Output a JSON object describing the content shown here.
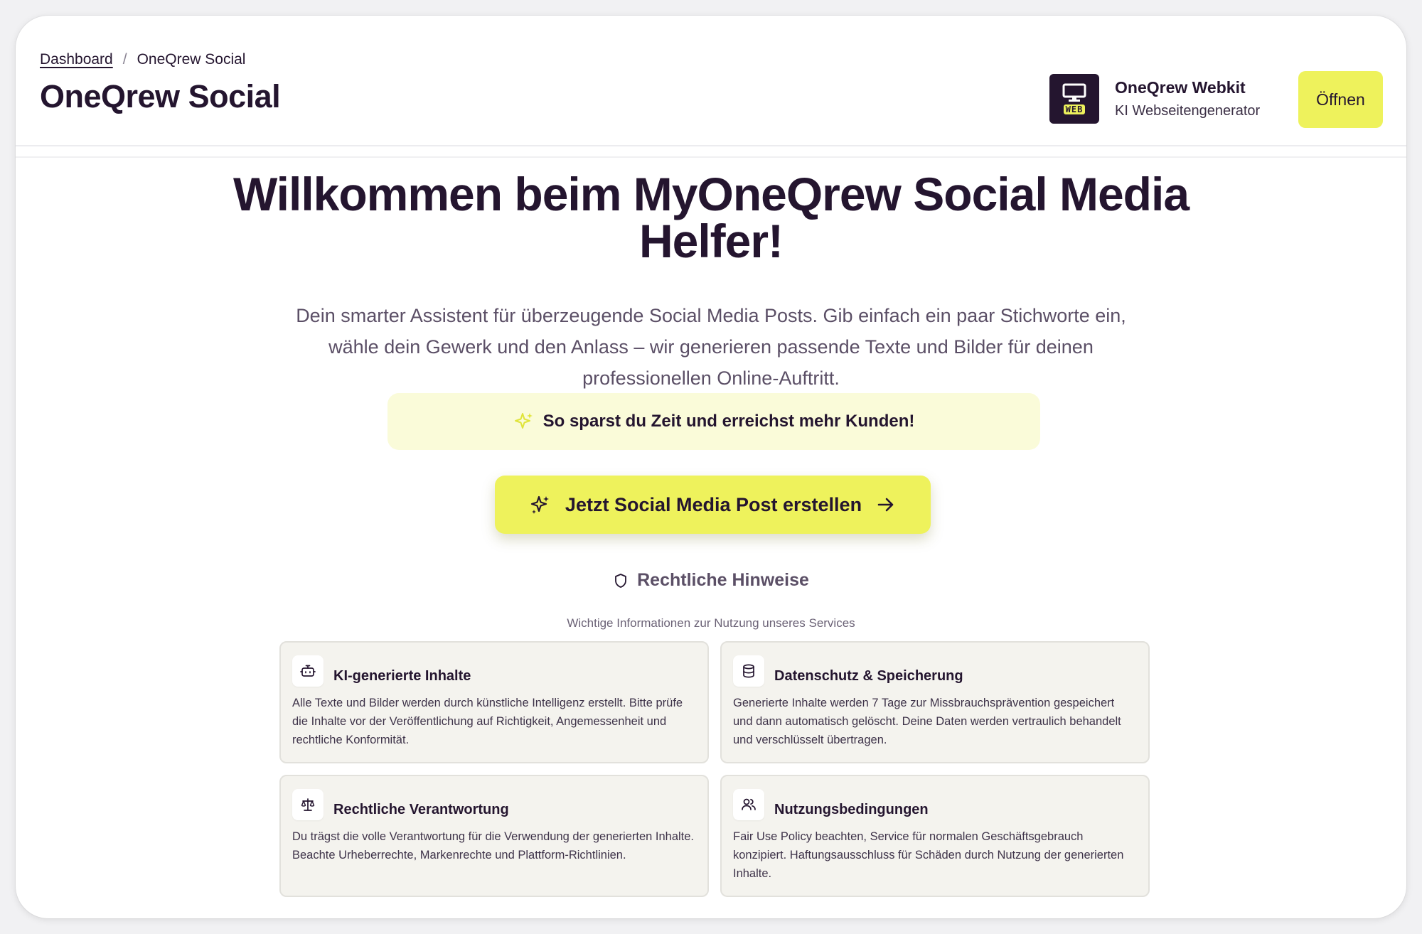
{
  "breadcrumb": {
    "home": "Dashboard",
    "separator": "/",
    "current": "OneQrew Social"
  },
  "header": {
    "title": "OneQrew Social"
  },
  "promo": {
    "logo_tag": "WEB",
    "name": "OneQrew Webkit",
    "description": "KI Webseitengenerator",
    "open_label": "Öffnen"
  },
  "hero": {
    "title": "Willkommen beim MyOneQrew Social Media Helfer!",
    "description": "Dein smarter Assistent für überzeugende Social Media Posts. Gib einfach ein paar Stichworte ein, wähle dein Gewerk und den Anlass – wir generieren passende Texte und Bilder für deinen professionellen Online-Auftritt.",
    "tip": "So sparst du Zeit und erreichst mehr Kunden!",
    "cta_label": "Jetzt Social Media Post erstellen"
  },
  "legal": {
    "title": "Rechtliche Hinweise",
    "subtitle": "Wichtige Informationen zur Nutzung unseres Services",
    "cards": [
      {
        "icon": "bot-icon",
        "title": "KI-generierte Inhalte",
        "text": "Alle Texte und Bilder werden durch künstliche Intelligenz erstellt. Bitte prüfe die Inhalte vor der Veröffentlichung auf Richtigkeit, Angemessenheit und rechtliche Konformität."
      },
      {
        "icon": "database-icon",
        "title": "Datenschutz & Speicherung",
        "text": "Generierte Inhalte werden 7 Tage zur Missbrauchsprävention gespeichert und dann automatisch gelöscht. Deine Daten werden vertraulich behandelt und verschlüsselt übertragen."
      },
      {
        "icon": "scale-icon",
        "title": "Rechtliche Verantwortung",
        "text": "Du trägst die volle Verantwortung für die Verwendung der generierten Inhalte. Beachte Urheberrechte, Markenrechte und Plattform-Richtlinien."
      },
      {
        "icon": "users-icon",
        "title": "Nutzungsbedingungen",
        "text": "Fair Use Policy beachten, Service für normalen Geschäftsgebrauch konzipiert. Haftungsausschluss für Schäden durch Nutzung der generierten Inhalte."
      }
    ]
  },
  "colors": {
    "accent": "#eef25c",
    "text": "#24152f",
    "tip_bg": "#fafbd9",
    "card_bg": "#f4f3ee"
  }
}
